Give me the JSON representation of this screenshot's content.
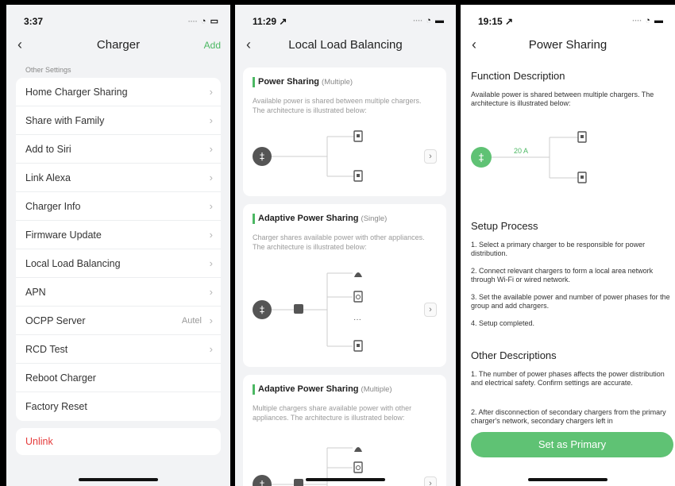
{
  "phone1": {
    "time": "3:37",
    "title": "Charger",
    "add_label": "Add",
    "section_label": "Other Settings",
    "rows": [
      {
        "label": "Home Charger Sharing",
        "value": ""
      },
      {
        "label": "Share with Family",
        "value": ""
      },
      {
        "label": "Add to Siri",
        "value": ""
      },
      {
        "label": "Link Alexa",
        "value": ""
      },
      {
        "label": "Charger Info",
        "value": ""
      },
      {
        "label": "Firmware Update",
        "value": ""
      },
      {
        "label": "Local Load Balancing",
        "value": ""
      },
      {
        "label": "APN",
        "value": ""
      },
      {
        "label": "OCPP Server",
        "value": "Autel"
      },
      {
        "label": "RCD Test",
        "value": ""
      },
      {
        "label": "Reboot Charger",
        "value": ""
      },
      {
        "label": "Factory Reset",
        "value": ""
      }
    ],
    "unlink": "Unlink"
  },
  "phone2": {
    "time": "11:29",
    "title": "Local Load Balancing",
    "cards": [
      {
        "title": "Power Sharing",
        "tag": "(Multiple)",
        "desc": "Available power is shared between multiple chargers. The architecture is illustrated below:"
      },
      {
        "title": "Adaptive Power Sharing",
        "tag": "(Single)",
        "desc": "Charger shares available power with other appliances. The architecture is illustrated below:"
      },
      {
        "title": "Adaptive Power Sharing",
        "tag": "(Multiple)",
        "desc": "Multiple chargers share available power with other appliances. The architecture is illustrated below:"
      }
    ],
    "dots": "···"
  },
  "phone3": {
    "time": "19:15",
    "title": "Power Sharing",
    "function_heading": "Function Description",
    "function_text": "Available power is shared between multiple chargers. The architecture is illustrated below:",
    "current_label": "20 A",
    "setup_heading": "Setup Process",
    "steps": [
      "1. Select a primary charger to be responsible for power distribution.",
      "2. Connect relevant chargers to form a local area network through Wi-Fi or wired network.",
      "3. Set the available power and number of power phases for the group and add chargers.",
      "4. Setup completed."
    ],
    "other_heading": "Other Descriptions",
    "other": [
      "1. The number of power phases affects the power distribution and electrical safety. Confirm settings are accurate.",
      "2. After disconnection of secondary chargers from the primary charger's network, secondary chargers left in"
    ],
    "button": "Set as Primary"
  },
  "colors": {
    "accent": "#4cb863",
    "danger": "#e53b3b",
    "icon_dark": "#555555"
  }
}
